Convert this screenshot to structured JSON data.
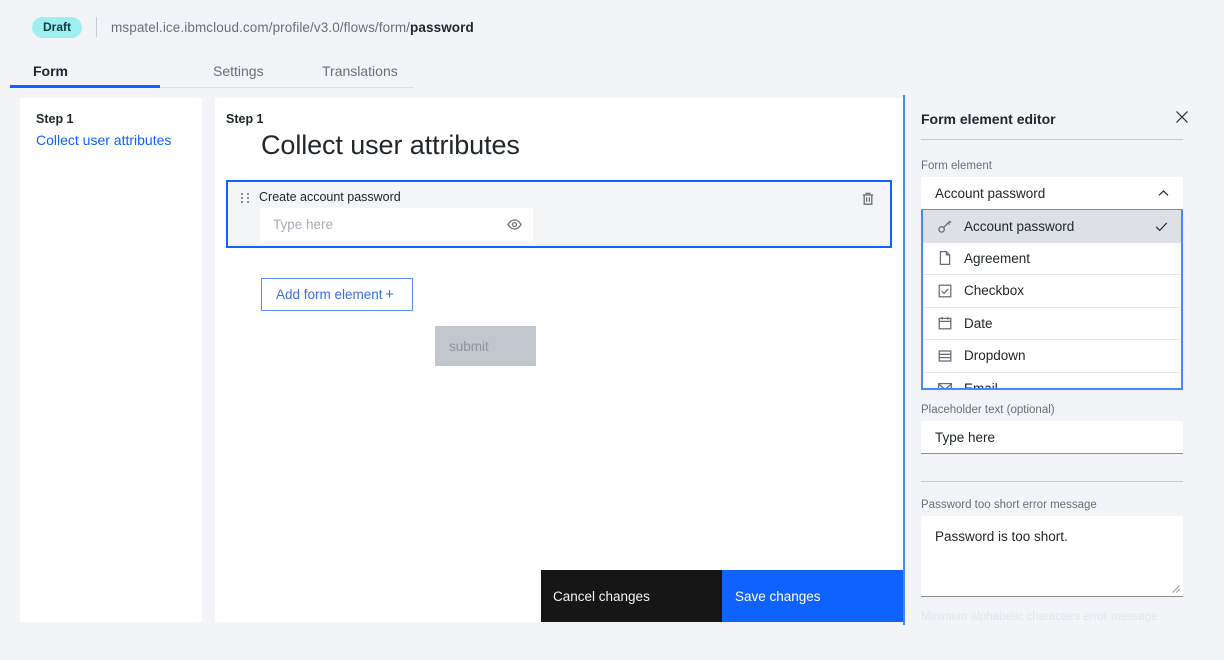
{
  "topbar": {
    "badge": "Draft",
    "breadcrumb_prefix": "mspatel.ice.ibmcloud.com/profile/v3.0/flows/form/",
    "breadcrumb_current": "password"
  },
  "tabs": [
    {
      "label": "Form",
      "active": true
    },
    {
      "label": "Settings",
      "active": false
    },
    {
      "label": "Translations",
      "active": false
    }
  ],
  "steps_panel": {
    "step_label": "Step 1",
    "step_link": "Collect user attributes"
  },
  "canvas": {
    "step_label": "Step 1",
    "title": "Collect user attributes",
    "form_element": {
      "label": "Create account password",
      "input_placeholder": "Type here",
      "drag_handle_icon": "drag-handle-icon",
      "reveal_icon": "eye-icon",
      "delete_icon": "trash-icon"
    },
    "add_button": {
      "label": "Add form element",
      "icon": "plus-icon"
    },
    "submit_button": "submit"
  },
  "action_bar": {
    "cancel": "Cancel changes",
    "save": "Save changes"
  },
  "editor": {
    "title": "Form element editor",
    "close_icon": "close-icon",
    "form_element_label": "Form element",
    "form_element_value": "Account password",
    "form_element_chevron": "chevron-up-icon",
    "options": [
      {
        "label": "Account password",
        "icon": "key-icon",
        "selected": true
      },
      {
        "label": "Agreement",
        "icon": "document-icon",
        "selected": false
      },
      {
        "label": "Checkbox",
        "icon": "checkbox-icon",
        "selected": false
      },
      {
        "label": "Date",
        "icon": "calendar-icon",
        "selected": false
      },
      {
        "label": "Dropdown",
        "icon": "list-icon",
        "selected": false
      },
      {
        "label": "Email",
        "icon": "envelope-icon",
        "selected": false
      }
    ],
    "placeholder_label": "Placeholder text (optional)",
    "placeholder_value": "Type here",
    "error_label": "Password too short error message",
    "error_value": "Password is too short.",
    "next_label_clipped": "Minimum alphabetic characters error message"
  },
  "colors": {
    "accent": "#0f62fe",
    "accent_light": "#4589ff",
    "badge": "#9ef0f0",
    "page_bg": "#f2f4f8",
    "dark": "#161616"
  }
}
